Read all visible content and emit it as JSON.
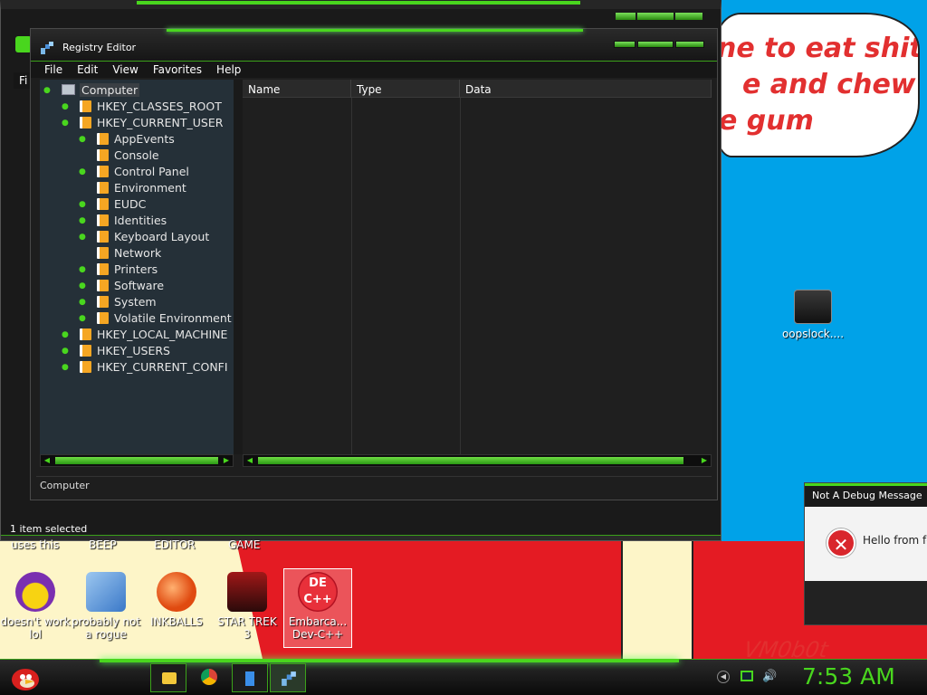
{
  "wallpaper": {
    "bubble_lines": [
      "ne to eat shit",
      "e and chew",
      "e gum"
    ],
    "signature": "VM0b0t"
  },
  "back_window": {
    "status": "1 item selected",
    "menu_partial": "Fi"
  },
  "registry": {
    "title": "Registry Editor",
    "menu": [
      "File",
      "Edit",
      "View",
      "Favorites",
      "Help"
    ],
    "tree": {
      "root": "Computer",
      "hives": [
        "HKEY_CLASSES_ROOT",
        "HKEY_CURRENT_USER"
      ],
      "current_user_children": [
        "AppEvents",
        "Console",
        "Control Panel",
        "Environment",
        "EUDC",
        "Identities",
        "Keyboard Layout",
        "Network",
        "Printers",
        "Software",
        "System",
        "Volatile Environment"
      ],
      "other_hives": [
        "HKEY_LOCAL_MACHINE",
        "HKEY_USERS",
        "HKEY_CURRENT_CONFI"
      ]
    },
    "columns": [
      "Name",
      "Type",
      "Data"
    ],
    "status": "Computer"
  },
  "debug_dialog": {
    "title": "Not A Debug Message",
    "message": "Hello from fo"
  },
  "desktop": {
    "top_captions": [
      "uses this",
      "BEEP",
      "EDITOR",
      "GAME"
    ],
    "icons": [
      {
        "label1": "doesn't work",
        "label2": "lol",
        "icon": "yahoo-messenger-icon"
      },
      {
        "label1": "probably not",
        "label2": "a rogue",
        "icon": "gear-window-icon"
      },
      {
        "label1": "INKBALLS",
        "label2": "",
        "icon": "inkball-icon"
      },
      {
        "label1": "STAR TREK",
        "label2": "3",
        "icon": "star-trek-icon"
      },
      {
        "label1": "Embarca...",
        "label2": "Dev-C++",
        "icon": "dev-cpp-icon"
      }
    ],
    "file_icon": {
      "label": "oopslock...."
    }
  },
  "taskbar": {
    "clock": "7:53 AM"
  },
  "colors": {
    "accent": "#49d61e",
    "desktop": "#00a2e8",
    "error": "#d9262c"
  }
}
